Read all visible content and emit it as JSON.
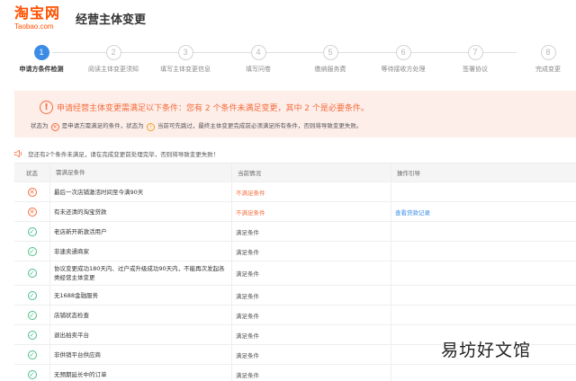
{
  "header": {
    "logo_main": "淘宝网",
    "logo_sub": "Taobao.com",
    "title": "经营主体变更"
  },
  "steps": [
    {
      "num": "1",
      "label": "申请方条件检测",
      "active": true
    },
    {
      "num": "2",
      "label": "阅读主体变更须知",
      "active": false
    },
    {
      "num": "3",
      "label": "填写主体变更信息",
      "active": false
    },
    {
      "num": "4",
      "label": "填写问卷",
      "active": false
    },
    {
      "num": "5",
      "label": "缴纳服务费",
      "active": false
    },
    {
      "num": "6",
      "label": "等待接收方处理",
      "active": false
    },
    {
      "num": "7",
      "label": "签署协议",
      "active": false
    },
    {
      "num": "8",
      "label": "完成变更",
      "active": false
    }
  ],
  "alert": {
    "title": "申请经营主体变更需满足以下条件：您有 2 个条件未满足变更，其中 2 个是必要条件。",
    "legend_1": "状态为",
    "legend_2": "是申请方需满足的条件，状态为",
    "legend_3": "当前可先跳过，最终主体变更完成前必须满足所有条件，否则将导致变更失败。"
  },
  "notice": "您还有2个条件未满足，请在完成变更前处理完毕，否则将导致变更失败！",
  "table": {
    "headers": [
      "状态",
      "需满足条件",
      "当前情况",
      "操作引导"
    ],
    "rows": [
      {
        "status": "fail",
        "condition": "最后一次店铺激活时间至今满90天",
        "result": "不满足条件",
        "action": ""
      },
      {
        "status": "fail",
        "condition": "有未还清的淘宝贷款",
        "result": "不满足条件",
        "action": "查看贷款记录"
      },
      {
        "status": "ok",
        "condition": "老店新开新激活用户",
        "result": "满足条件",
        "action": ""
      },
      {
        "status": "ok",
        "condition": "非速卖通商家",
        "result": "满足条件",
        "action": ""
      },
      {
        "status": "ok",
        "condition": "协议变更成功180天内、过户或升级成功90天内，不能再次发起各类经营主体变更",
        "result": "满足条件",
        "action": ""
      },
      {
        "status": "ok",
        "condition": "无1688金融服务",
        "result": "满足条件",
        "action": ""
      },
      {
        "status": "ok",
        "condition": "店铺状态检查",
        "result": "满足条件",
        "action": ""
      },
      {
        "status": "ok",
        "condition": "退出拍卖平台",
        "result": "满足条件",
        "action": ""
      },
      {
        "status": "ok",
        "condition": "非供销平台供应商",
        "result": "满足条件",
        "action": ""
      },
      {
        "status": "ok",
        "condition": "无预期延长中的订单",
        "result": "满足条件",
        "action": ""
      }
    ]
  },
  "watermark": "易坊好文馆",
  "colors": {
    "brand": "#ff5000",
    "accent": "#3c8ce7",
    "fail": "#f56c3b",
    "ok": "#4cbc8a",
    "alert_bg": "#fdeeea"
  }
}
